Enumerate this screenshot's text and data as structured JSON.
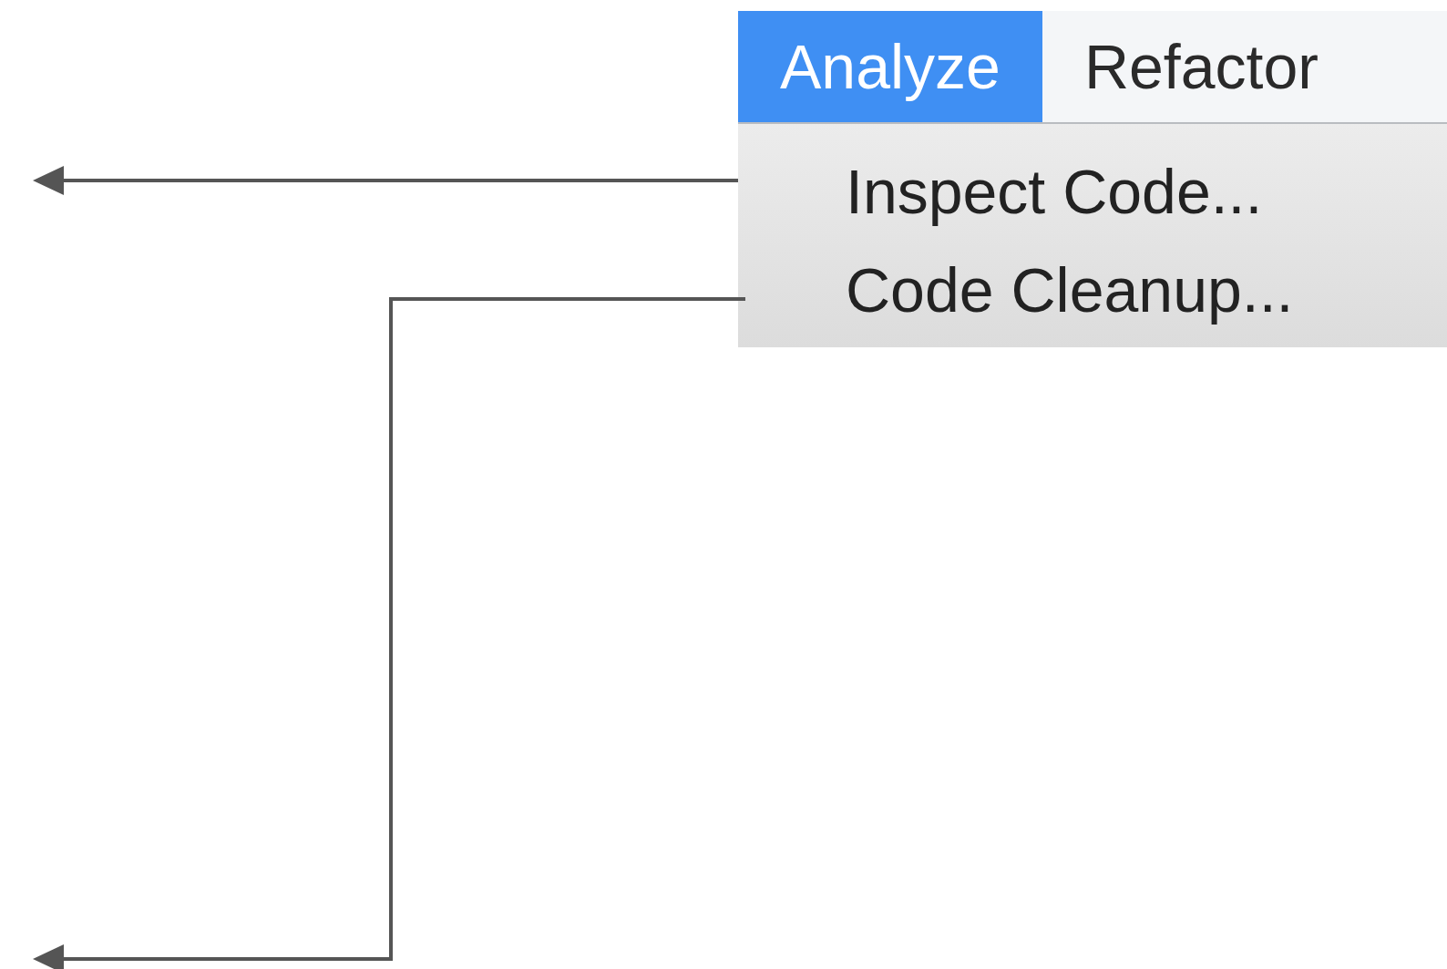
{
  "menu_bar": [
    {
      "label": "Analyze",
      "selected": true
    },
    {
      "label": "Refactor",
      "selected": false
    }
  ],
  "menu_items": [
    {
      "label": "Inspect Code..."
    },
    {
      "label": "Code Cleanup..."
    }
  ]
}
